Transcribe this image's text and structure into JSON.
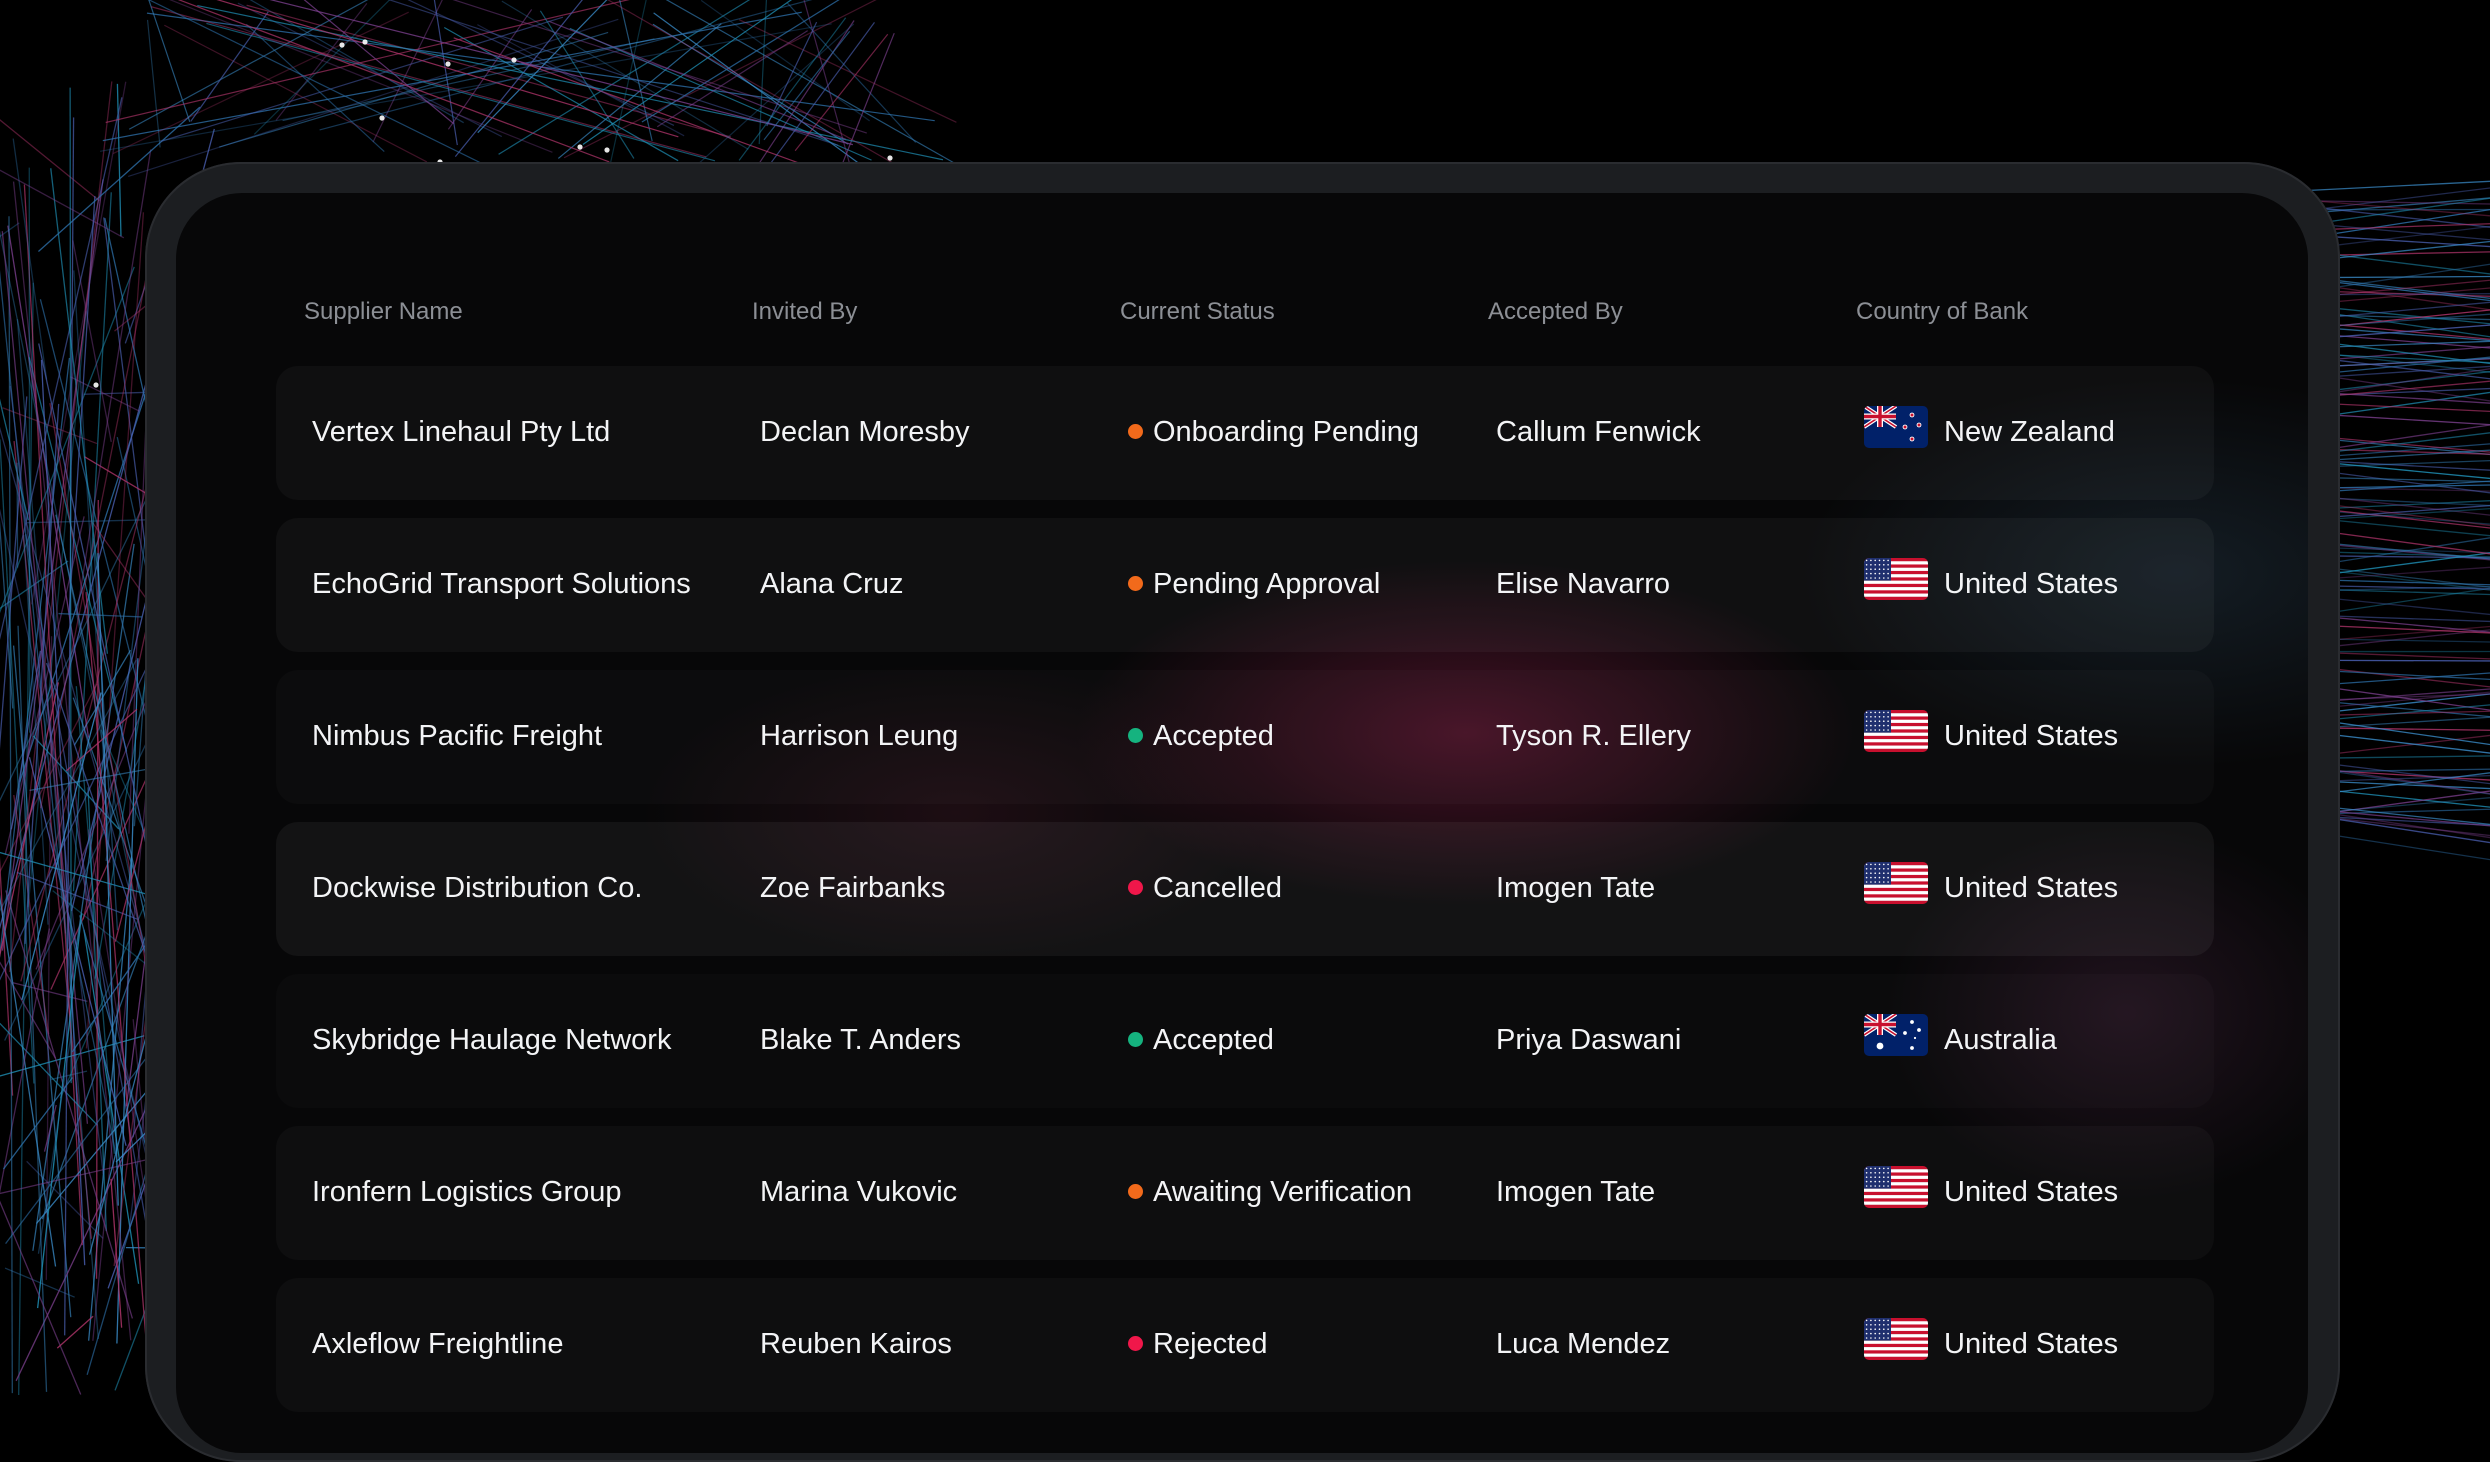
{
  "table": {
    "columns": [
      "Supplier Name",
      "Invited By",
      "Current Status",
      "Accepted By",
      "Country of Bank"
    ],
    "rows": [
      {
        "supplier": "Vertex Linehaul Pty Ltd",
        "invited_by": "Declan Moresby",
        "status": "Onboarding Pending",
        "status_color": "#f26a1b",
        "accepted_by": "Callum Fenwick",
        "country": "New Zealand",
        "flag": "nz-flag-icon"
      },
      {
        "supplier": "EchoGrid Transport Solutions",
        "invited_by": "Alana Cruz",
        "status": "Pending Approval",
        "status_color": "#f26a1b",
        "accepted_by": "Elise Navarro",
        "country": "United States",
        "flag": "us-flag-icon"
      },
      {
        "supplier": "Nimbus Pacific Freight",
        "invited_by": "Harrison Leung",
        "status": "Accepted",
        "status_color": "#15b37f",
        "accepted_by": "Tyson R. Ellery",
        "country": "United States",
        "flag": "us-flag-icon"
      },
      {
        "supplier": "Dockwise Distribution Co.",
        "invited_by": "Zoe Fairbanks",
        "status": "Cancelled",
        "status_color": "#f0174a",
        "accepted_by": "Imogen Tate",
        "country": "United States",
        "flag": "us-flag-icon"
      },
      {
        "supplier": "Skybridge Haulage Network",
        "invited_by": "Blake T. Anders",
        "status": "Accepted",
        "status_color": "#15b37f",
        "accepted_by": "Priya Daswani",
        "country": "Australia",
        "flag": "au-flag-icon"
      },
      {
        "supplier": "Ironfern Logistics Group",
        "invited_by": "Marina Vukovic",
        "status": "Awaiting Verification",
        "status_color": "#f26a1b",
        "accepted_by": "Imogen Tate",
        "country": "United States",
        "flag": "us-flag-icon"
      },
      {
        "supplier": "Axleflow Freightline",
        "invited_by": "Reuben Kairos",
        "status": "Rejected",
        "status_color": "#f0174a",
        "accepted_by": "Luca Mendez",
        "country": "United States",
        "flag": "us-flag-icon"
      }
    ]
  }
}
